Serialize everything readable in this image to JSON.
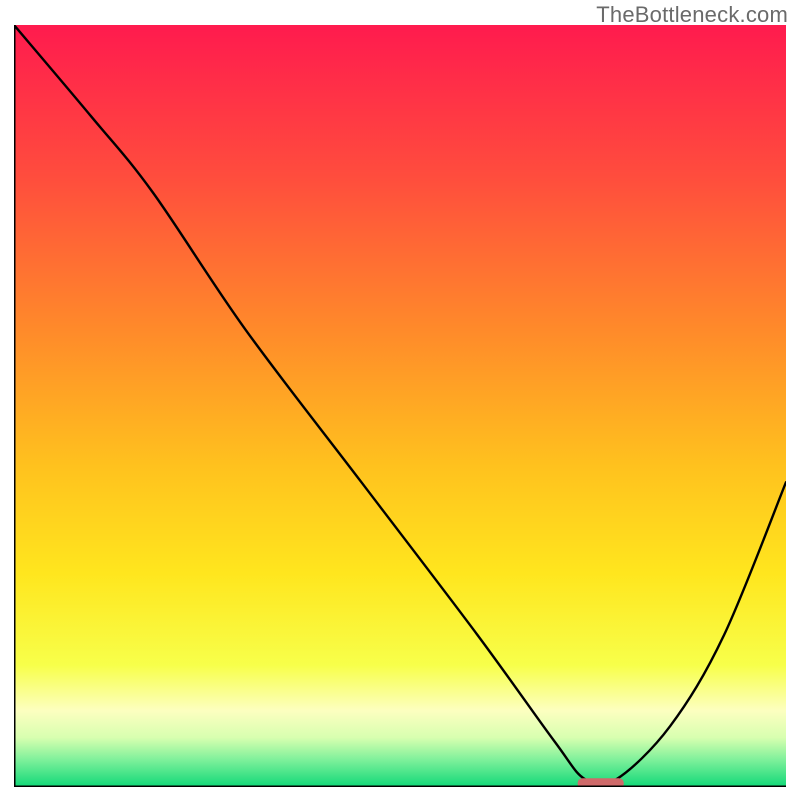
{
  "watermark": "TheBottleneck.com",
  "chart_data": {
    "type": "line",
    "title": "",
    "xlabel": "",
    "ylabel": "",
    "xlim": [
      0,
      100
    ],
    "ylim": [
      0,
      100
    ],
    "grid": false,
    "legend": false,
    "axes_visible": {
      "left": true,
      "bottom": true,
      "top": false,
      "right": false
    },
    "series": [
      {
        "name": "curve",
        "color": "#000000",
        "x": [
          0,
          10,
          18,
          30,
          45,
          60,
          70,
          74,
          78,
          85,
          92,
          100
        ],
        "values": [
          100,
          88,
          78,
          60,
          40,
          20,
          6,
          1,
          1,
          8,
          20,
          40
        ]
      }
    ],
    "marker": {
      "name": "optimal-point",
      "x_range": [
        73,
        79
      ],
      "y": 0.5,
      "color": "#cf6a6a"
    },
    "background_gradient": {
      "stops": [
        {
          "offset": 0.0,
          "color": "#ff1b4e"
        },
        {
          "offset": 0.2,
          "color": "#ff4d3d"
        },
        {
          "offset": 0.4,
          "color": "#ff8a2a"
        },
        {
          "offset": 0.58,
          "color": "#ffc21e"
        },
        {
          "offset": 0.72,
          "color": "#ffe61e"
        },
        {
          "offset": 0.84,
          "color": "#f7ff4a"
        },
        {
          "offset": 0.9,
          "color": "#fcffc0"
        },
        {
          "offset": 0.935,
          "color": "#d8ffb0"
        },
        {
          "offset": 0.965,
          "color": "#7cf09a"
        },
        {
          "offset": 1.0,
          "color": "#11d878"
        }
      ]
    }
  }
}
